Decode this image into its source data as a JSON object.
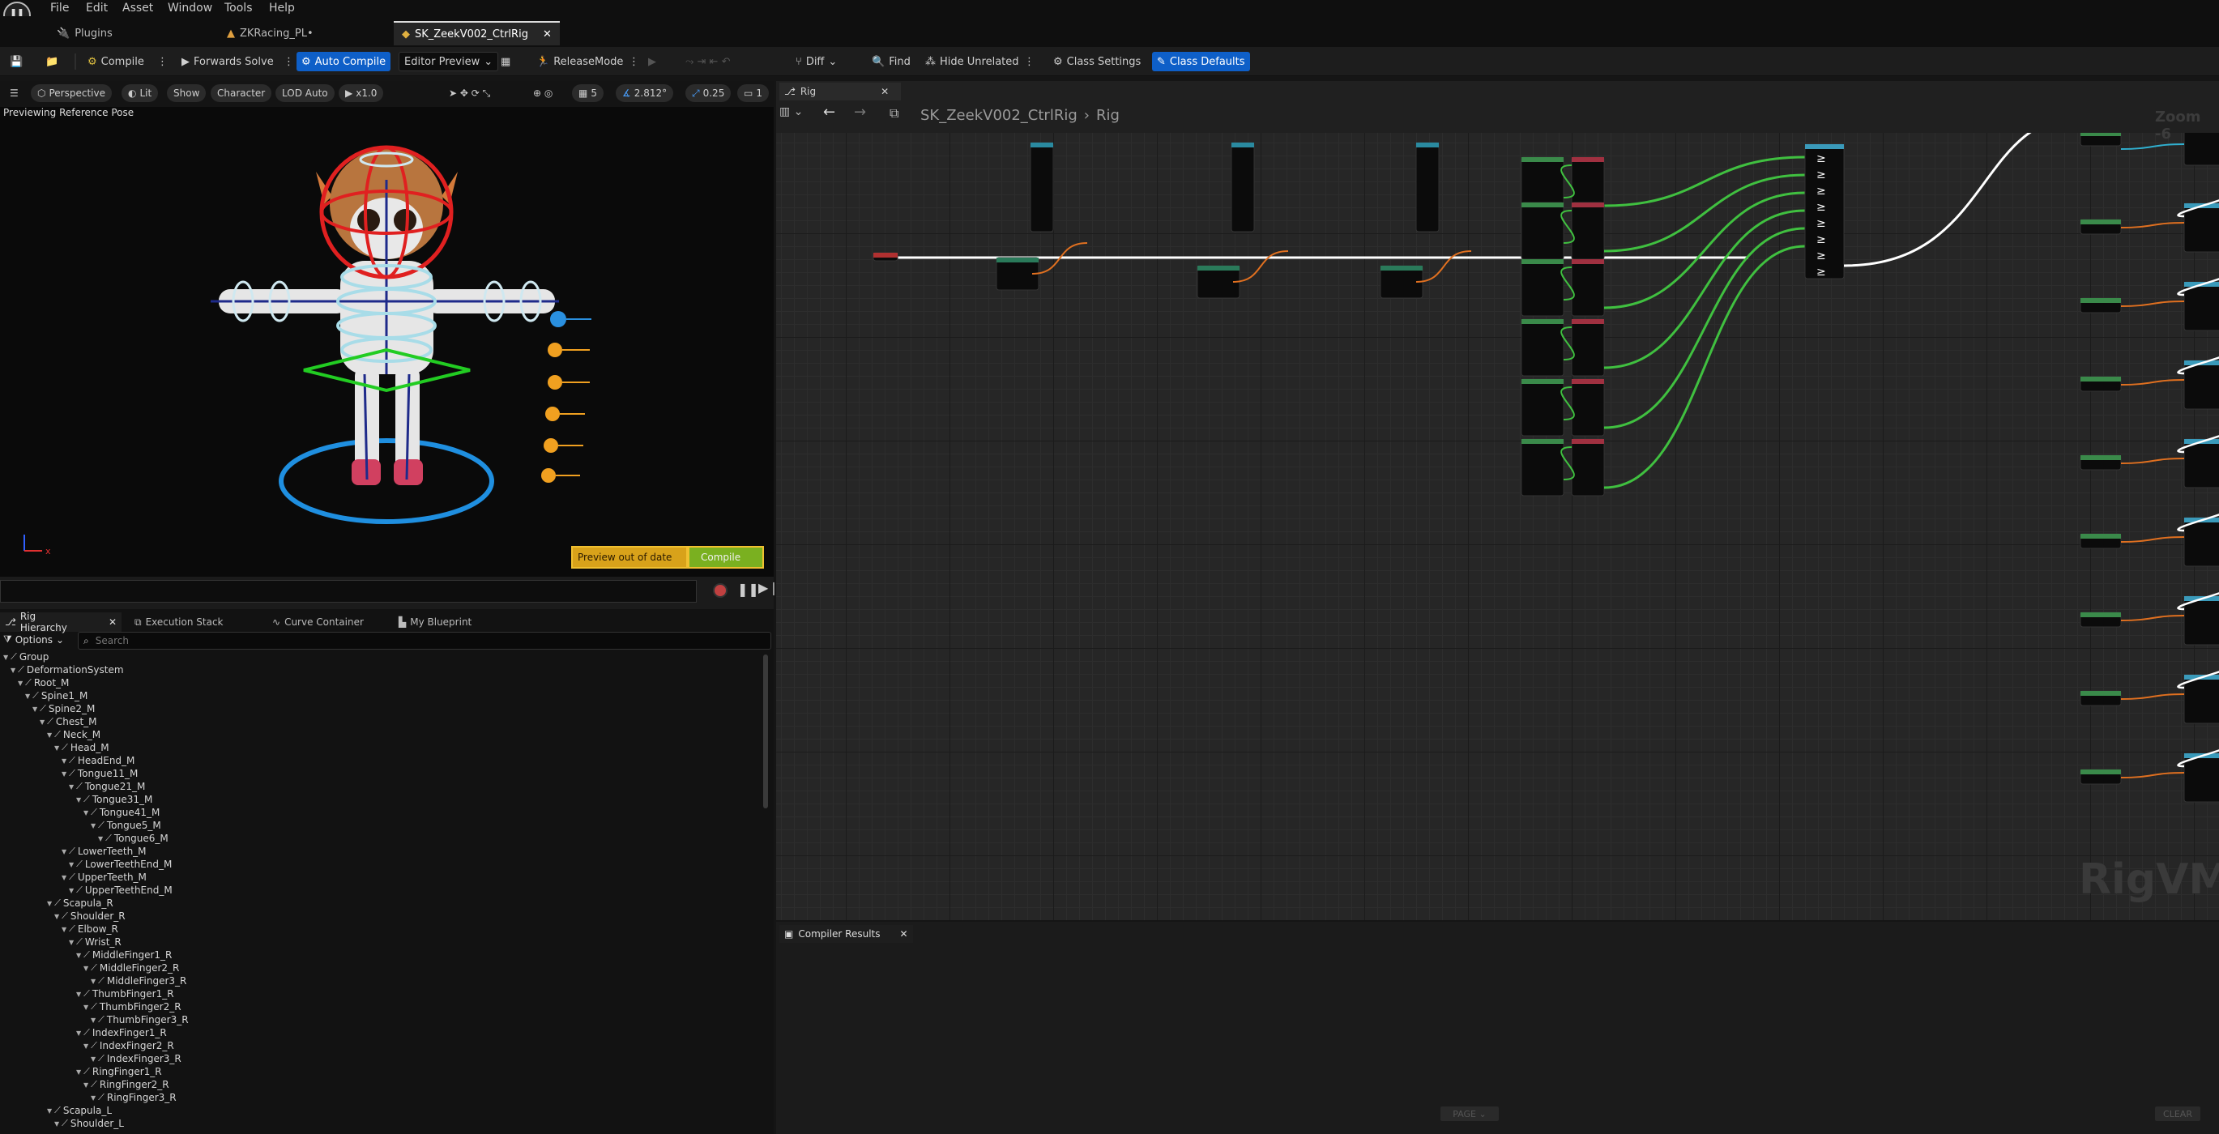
{
  "menu": {
    "items": [
      "File",
      "Edit",
      "Asset",
      "Window",
      "Tools",
      "Help"
    ]
  },
  "tabs": [
    {
      "label": "Plugins"
    },
    {
      "label": "ZKRacing_PL•"
    },
    {
      "label": "SK_ZeekV002_CtrlRig",
      "active": true
    }
  ],
  "toolbar": {
    "compile": "Compile",
    "forwards_solve": "Forwards Solve",
    "auto_compile": "Auto Compile",
    "editor_preview": "Editor Preview",
    "release_mode": "ReleaseMode",
    "diff": "Diff",
    "find": "Find",
    "hide_unrelated": "Hide Unrelated",
    "class_settings": "Class Settings",
    "class_defaults": "Class Defaults"
  },
  "viewport": {
    "perspective": "Perspective",
    "lit": "Lit",
    "show": "Show",
    "character": "Character",
    "lod": "LOD Auto",
    "speed": "x1.0",
    "grid_size": "5",
    "angle": "2.812°",
    "scale": "0.25",
    "cam": "1",
    "status": "Previewing Reference Pose",
    "preview_out_of_date": "Preview out of date",
    "compile_btn": "Compile"
  },
  "hierarchy": {
    "tabs": [
      "Rig Hierarchy",
      "Execution Stack",
      "Curve Container",
      "My Blueprint"
    ],
    "options": "Options",
    "search_placeholder": "Search",
    "items": [
      {
        "label": "Group",
        "depth": 0
      },
      {
        "label": "DeformationSystem",
        "depth": 1
      },
      {
        "label": "Root_M",
        "depth": 2
      },
      {
        "label": "Spine1_M",
        "depth": 3
      },
      {
        "label": "Spine2_M",
        "depth": 4
      },
      {
        "label": "Chest_M",
        "depth": 5
      },
      {
        "label": "Neck_M",
        "depth": 6
      },
      {
        "label": "Head_M",
        "depth": 7
      },
      {
        "label": "HeadEnd_M",
        "depth": 8
      },
      {
        "label": "Tongue11_M",
        "depth": 8
      },
      {
        "label": "Tongue21_M",
        "depth": 9
      },
      {
        "label": "Tongue31_M",
        "depth": 10
      },
      {
        "label": "Tongue41_M",
        "depth": 11
      },
      {
        "label": "Tongue5_M",
        "depth": 12
      },
      {
        "label": "Tongue6_M",
        "depth": 13
      },
      {
        "label": "LowerTeeth_M",
        "depth": 8
      },
      {
        "label": "LowerTeethEnd_M",
        "depth": 9
      },
      {
        "label": "UpperTeeth_M",
        "depth": 8
      },
      {
        "label": "UpperTeethEnd_M",
        "depth": 9
      },
      {
        "label": "Scapula_R",
        "depth": 6
      },
      {
        "label": "Shoulder_R",
        "depth": 7
      },
      {
        "label": "Elbow_R",
        "depth": 8
      },
      {
        "label": "Wrist_R",
        "depth": 9
      },
      {
        "label": "MiddleFinger1_R",
        "depth": 10
      },
      {
        "label": "MiddleFinger2_R",
        "depth": 11
      },
      {
        "label": "MiddleFinger3_R",
        "depth": 12
      },
      {
        "label": "ThumbFinger1_R",
        "depth": 10
      },
      {
        "label": "ThumbFinger2_R",
        "depth": 11
      },
      {
        "label": "ThumbFinger3_R",
        "depth": 12
      },
      {
        "label": "IndexFinger1_R",
        "depth": 10
      },
      {
        "label": "IndexFinger2_R",
        "depth": 11
      },
      {
        "label": "IndexFinger3_R",
        "depth": 12
      },
      {
        "label": "RingFinger1_R",
        "depth": 10
      },
      {
        "label": "RingFinger2_R",
        "depth": 11
      },
      {
        "label": "RingFinger3_R",
        "depth": 12
      },
      {
        "label": "Scapula_L",
        "depth": 6
      },
      {
        "label": "Shoulder_L",
        "depth": 7
      }
    ]
  },
  "graph": {
    "tab": "Rig",
    "breadcrumb_root": "SK_ZeekV002_CtrlRig",
    "breadcrumb_leaf": "Rig",
    "zoom": "Zoom -6",
    "watermark": "RigVM"
  },
  "compiler": {
    "tab": "Compiler Results",
    "page": "PAGE",
    "clear": "CLEAR"
  }
}
